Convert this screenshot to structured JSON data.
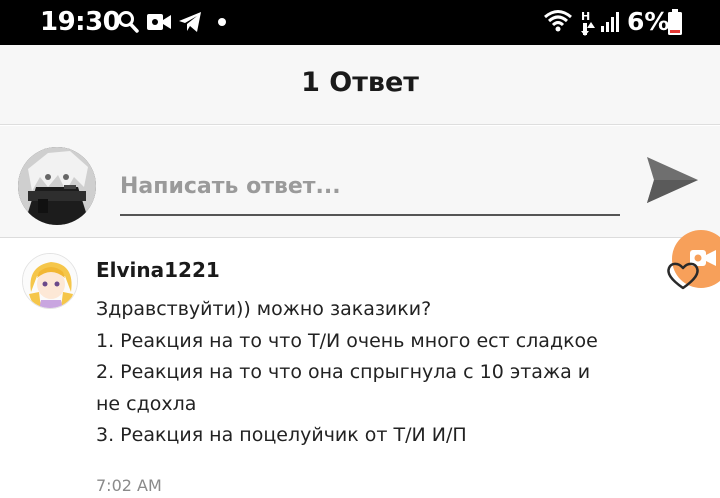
{
  "status_bar": {
    "time": "19:30",
    "battery_percent": "6%",
    "icons": [
      "search-icon",
      "video-camera-icon",
      "telegram-icon",
      "dot-icon",
      "wifi-icon",
      "data-arrows-icon",
      "signal-icon",
      "battery-icon"
    ]
  },
  "header": {
    "title": "1 Ответ"
  },
  "composer": {
    "placeholder": "Написать ответ...",
    "send_icon": "send-icon"
  },
  "comment": {
    "author": "Elvina1221",
    "lines": [
      "Здравствуйти)) можно заказики?",
      "1. Реакция на то что Т/И очень много ест сладкое",
      "2. Реакция на то что она спрыгнула с 10 этажа и",
      "не сдохла",
      "3. Реакция на поцелуйчик от Т/И И/П"
    ],
    "time": "7:02 AM",
    "like_icon": "heart-icon"
  },
  "colors": {
    "status_bar_bg": "#000000",
    "header_bg": "#f7f7f7",
    "battery_low": "#e53935",
    "floating_button": "#f7a05a"
  }
}
